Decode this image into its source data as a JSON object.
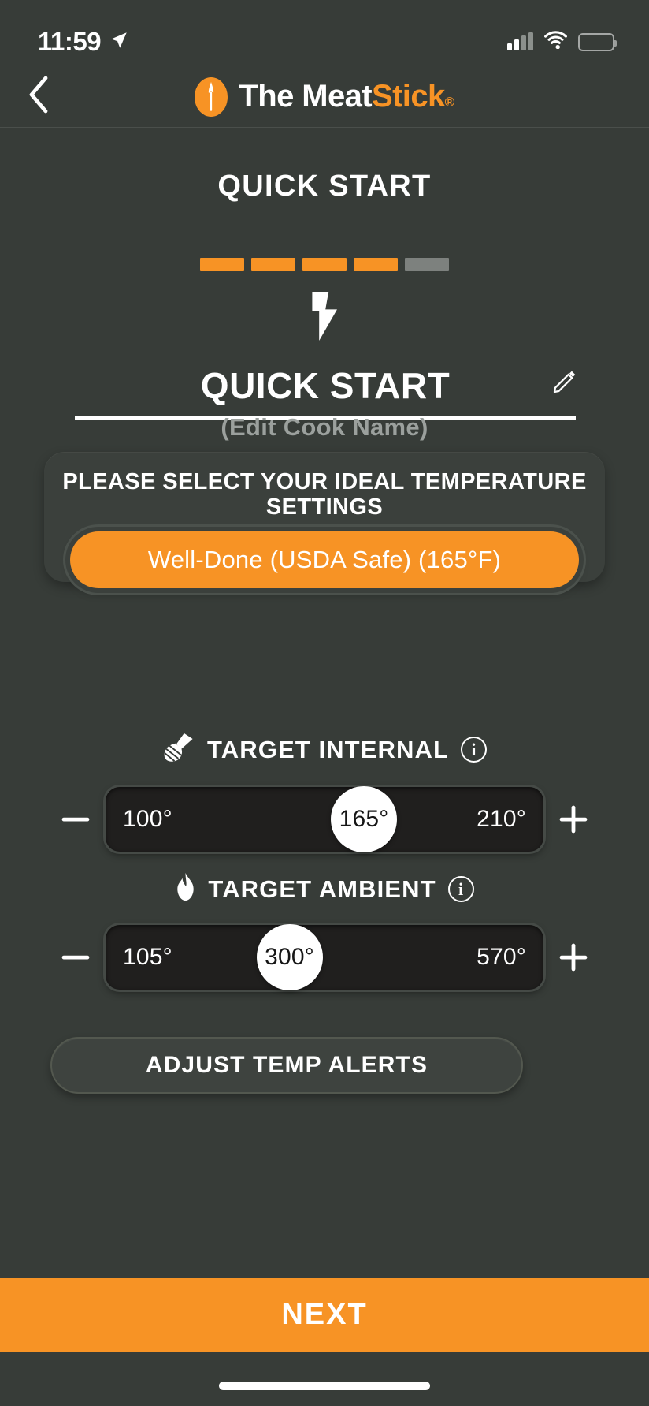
{
  "status_bar": {
    "time": "11:59",
    "location_icon": "location-arrow-icon",
    "signal_icon": "cellular-signal-icon",
    "wifi_icon": "wifi-icon",
    "battery_icon": "battery-icon"
  },
  "nav": {
    "back_icon": "chevron-left-icon",
    "brand_primary": "The Meat",
    "brand_accent": "Stick",
    "brand_registered": "®",
    "brand_mark_icon": "meatstick-probe-logo-icon"
  },
  "header": {
    "screen_title": "QUICK START"
  },
  "progress": {
    "total_steps": 5,
    "completed_steps": 4,
    "done_color": "#f79325",
    "todo_color": "#7d817e"
  },
  "cook": {
    "type_icon": "lightning-bolt-icon",
    "name": "QUICK START",
    "edit_icon": "pencil-edit-icon",
    "hint": "(Edit Cook Name)"
  },
  "doneness_card": {
    "title": "PLEASE SELECT YOUR IDEAL TEMPERATURE SETTINGS",
    "selected_option": "Well-Done (USDA Safe) (165°F)",
    "selected_color": "#f79325"
  },
  "target_internal": {
    "icon": "meat-probe-icon",
    "label": "TARGET INTERNAL",
    "info_icon": "info-circle-icon",
    "minus_icon": "minus-icon",
    "plus_icon": "plus-icon",
    "min": "100°",
    "value": "165°",
    "max": "210°",
    "thumb_percent": 59
  },
  "target_ambient": {
    "icon": "flame-icon",
    "label": "TARGET AMBIENT",
    "info_icon": "info-circle-icon",
    "minus_icon": "minus-icon",
    "plus_icon": "plus-icon",
    "min": "105°",
    "value": "300°",
    "max": "570°",
    "thumb_percent": 42
  },
  "actions": {
    "adjust_alerts": "ADJUST TEMP ALERTS",
    "next": "NEXT"
  }
}
